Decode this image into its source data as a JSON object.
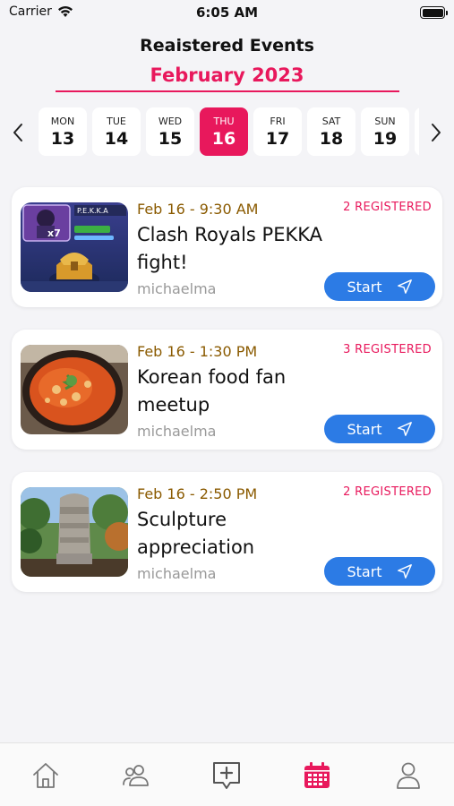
{
  "status_bar": {
    "carrier": "Carrier",
    "time": "6:05 AM"
  },
  "header": {
    "title": "Reaistered Events",
    "month": "February 2023"
  },
  "day_selector": {
    "days": [
      {
        "dow": "MON",
        "num": "13"
      },
      {
        "dow": "TUE",
        "num": "14"
      },
      {
        "dow": "WED",
        "num": "15"
      },
      {
        "dow": "THU",
        "num": "16",
        "selected": true
      },
      {
        "dow": "FRI",
        "num": "17"
      },
      {
        "dow": "SAT",
        "num": "18"
      },
      {
        "dow": "SUN",
        "num": "19"
      }
    ]
  },
  "events": [
    {
      "time": "Feb 16 - 9:30 AM",
      "title": "Clash Royals PEKKA fight!",
      "host": "michaelma",
      "registered": "2 REGISTERED",
      "start_label": "Start",
      "thumb_text": "P.E.K.K.A",
      "thumb_badge": "x7"
    },
    {
      "time": "Feb 16 - 1:30 PM",
      "title": "Korean food fan meetup",
      "host": "michaelma",
      "registered": "3 REGISTERED",
      "start_label": "Start"
    },
    {
      "time": "Feb 16 - 2:50 PM",
      "title": "Sculpture appreciation",
      "host": "michaelma",
      "registered": "2 REGISTERED",
      "start_label": "Start"
    }
  ],
  "tab_bar": {
    "items": [
      {
        "icon": "home-icon"
      },
      {
        "icon": "people-icon"
      },
      {
        "icon": "add-message-icon"
      },
      {
        "icon": "calendar-icon",
        "active": true
      },
      {
        "icon": "profile-icon"
      }
    ]
  },
  "colors": {
    "accent": "#e8185c",
    "button": "#2c7be5",
    "time": "#8a5a00"
  }
}
